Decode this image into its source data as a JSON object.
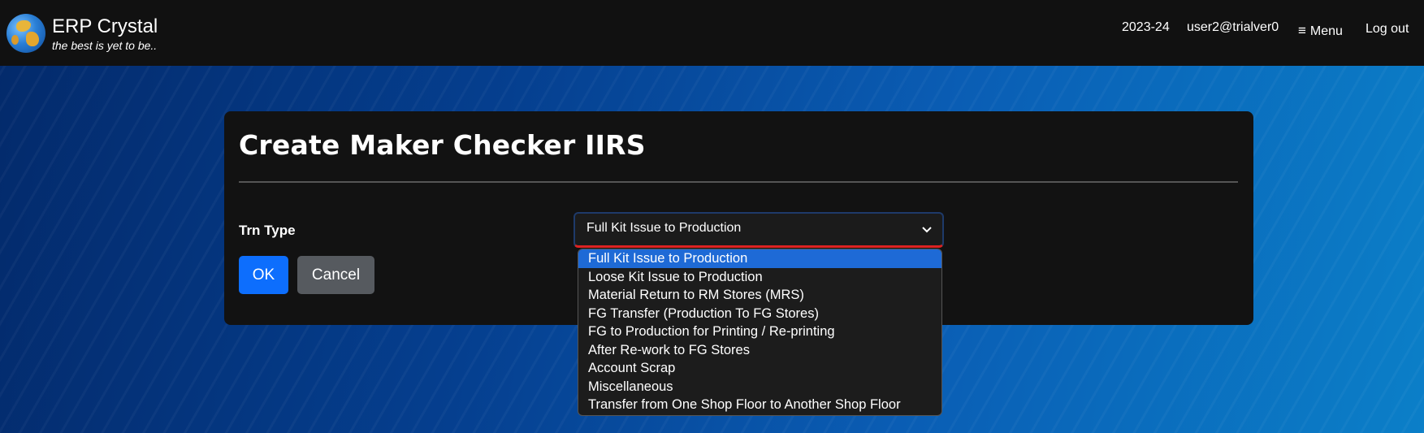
{
  "header": {
    "app_title": "ERP Crystal",
    "tagline": "the best is yet to be..",
    "fiscal_year": "2023-24",
    "user": "user2@trialver0",
    "menu_label": "Menu",
    "menu_icon": "hamburger-icon",
    "logout_label": "Log out"
  },
  "form": {
    "title": "Create Maker Checker IIRS",
    "trn_type_label": "Trn Type",
    "selected_value": "Full Kit Issue to Production",
    "ok_label": "OK",
    "cancel_label": "Cancel"
  },
  "dropdown": {
    "options": [
      "Full Kit Issue to Production",
      "Loose Kit Issue to Production",
      "Material Return to RM Stores (MRS)",
      "FG Transfer (Production To FG Stores)",
      "FG to Production for Printing / Re-printing",
      "After Re-work to FG Stores",
      "Account Scrap",
      "Miscellaneous",
      "Transfer from One Shop Floor to Another Shop Floor"
    ],
    "highlighted_index": 0
  },
  "colors": {
    "navbar": "#111111",
    "card": "#121212",
    "primary_button": "#0d6efd",
    "secondary_button": "#565a5f",
    "highlight": "#1e6ad6"
  }
}
